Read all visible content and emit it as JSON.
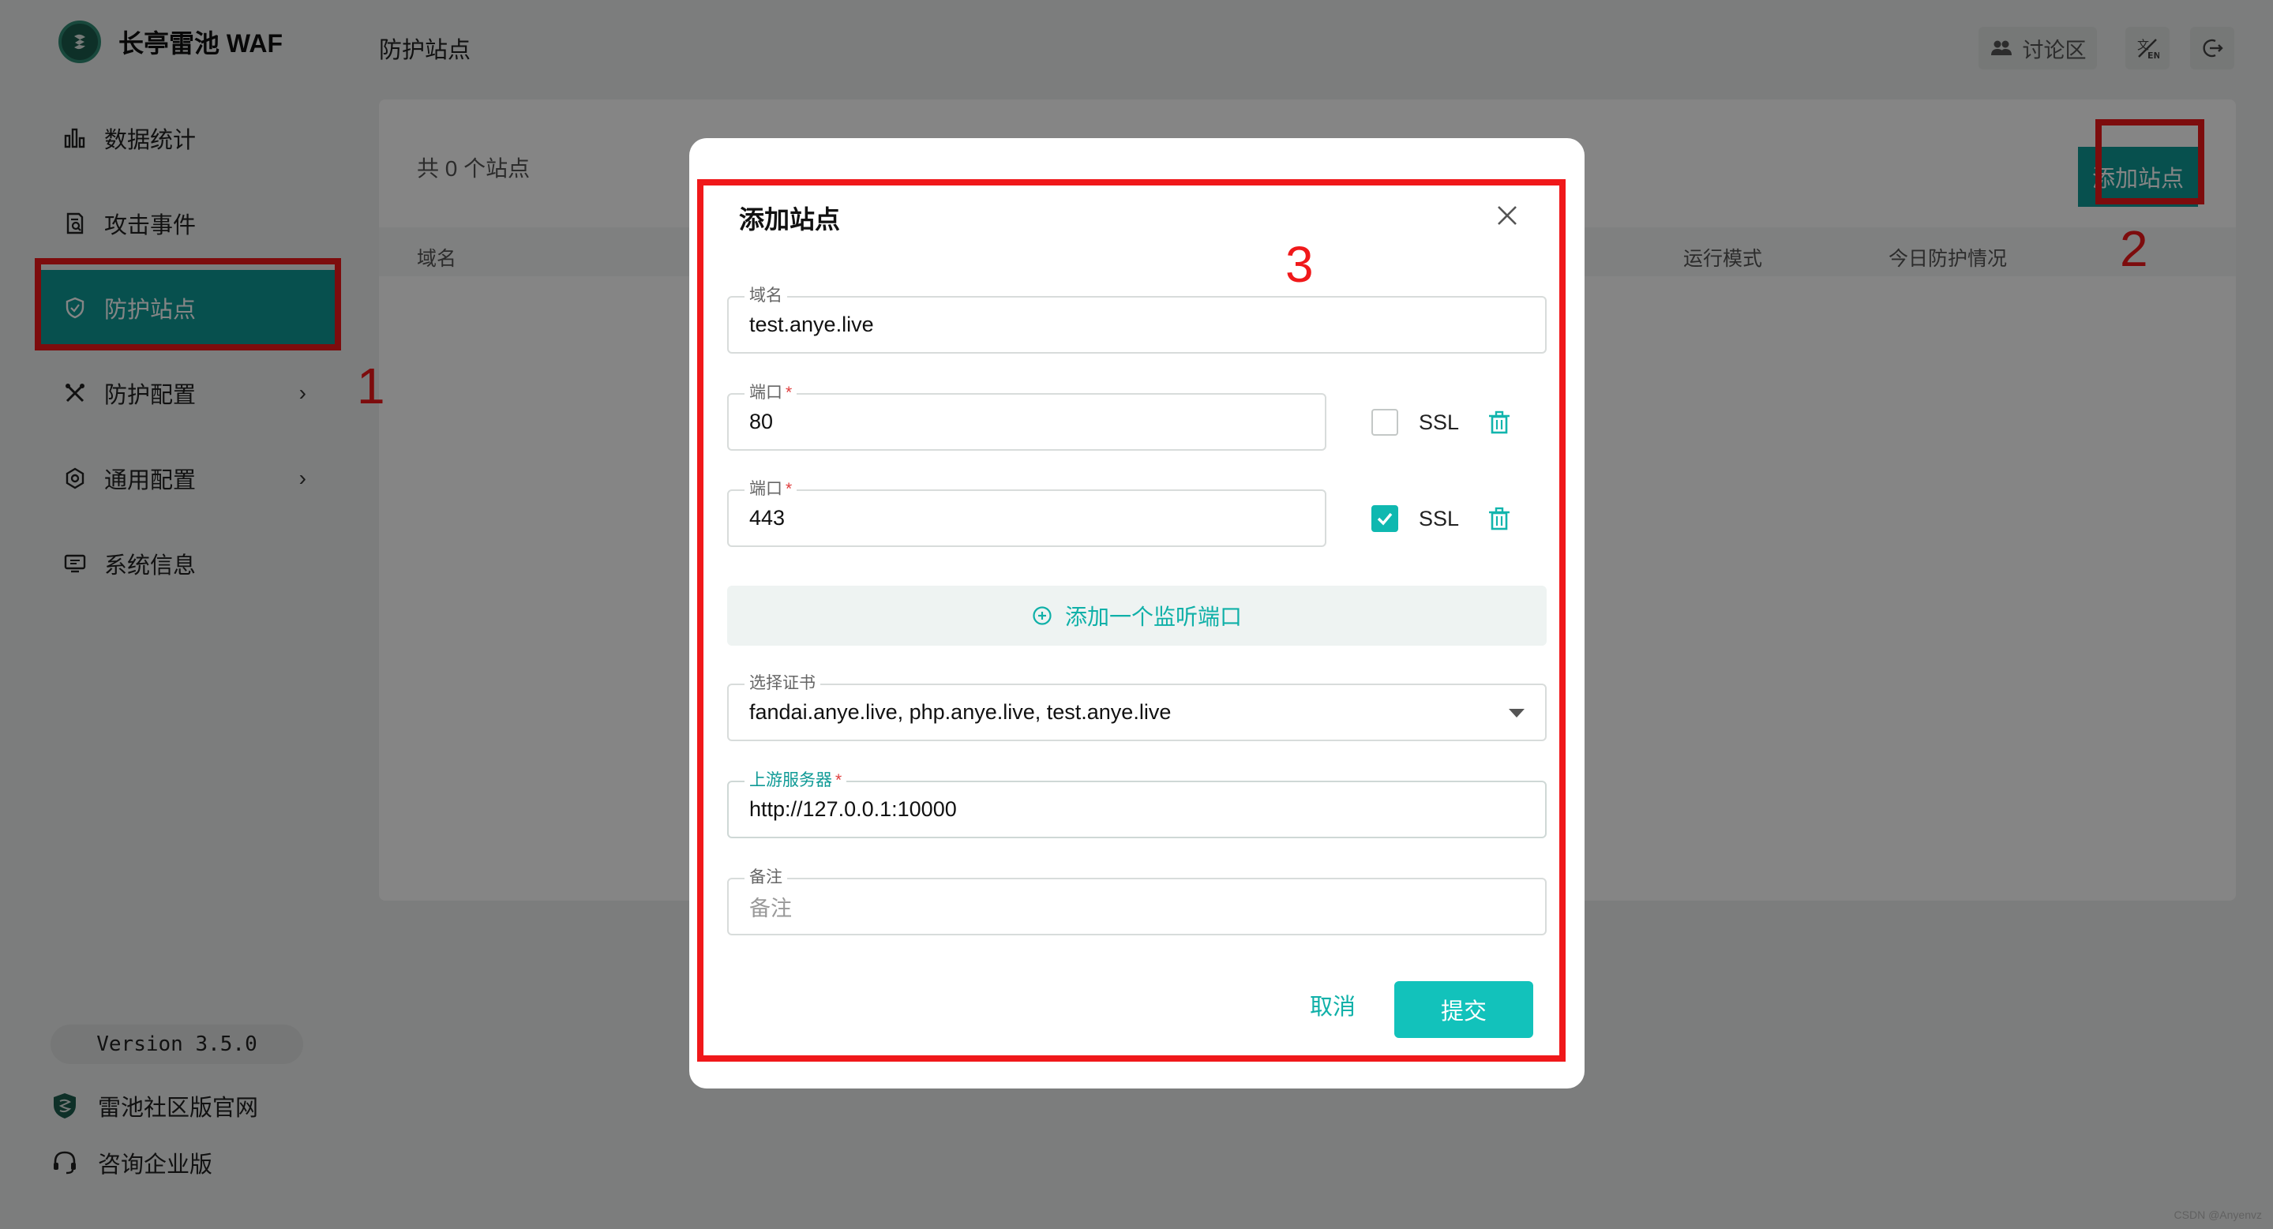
{
  "app": {
    "title": "长亭雷池 WAF",
    "version": "Version 3.5.0"
  },
  "sidebar": {
    "items": [
      {
        "label": "数据统计"
      },
      {
        "label": "攻击事件"
      },
      {
        "label": "防护站点"
      },
      {
        "label": "防护配置"
      },
      {
        "label": "通用配置"
      },
      {
        "label": "系统信息"
      }
    ],
    "footer": [
      {
        "label": "雷池社区版官网"
      },
      {
        "label": "咨询企业版"
      }
    ]
  },
  "topbar": {
    "page_title": "防护站点",
    "forum_label": "讨论区"
  },
  "content": {
    "site_count": "共 0 个站点",
    "add_site_label": "添加站点",
    "columns": [
      "域名",
      "运行模式",
      "今日防护情况"
    ]
  },
  "annotations": [
    "1",
    "2",
    "3"
  ],
  "modal": {
    "title": "添加站点",
    "domain": {
      "label": "域名",
      "value": "test.anye.live"
    },
    "ports": [
      {
        "label": "端口",
        "required": "*",
        "value": "80",
        "ssl_label": "SSL",
        "ssl_checked": false
      },
      {
        "label": "端口",
        "required": "*",
        "value": "443",
        "ssl_label": "SSL",
        "ssl_checked": true
      }
    ],
    "add_port_label": "添加一个监听端口",
    "certificate": {
      "label": "选择证书",
      "value": "fandai.anye.live, php.anye.live, test.anye.live"
    },
    "upstream": {
      "label": "上游服务器",
      "required": "*",
      "value": "http://127.0.0.1:10000"
    },
    "remark": {
      "label": "备注",
      "placeholder": "备注"
    },
    "cancel_label": "取消",
    "submit_label": "提交"
  },
  "watermark": "CSDN @Anyenvz",
  "colors": {
    "accent": "#0f9a96",
    "accent_light": "#12c2bb",
    "annotation": "#f0181a"
  }
}
